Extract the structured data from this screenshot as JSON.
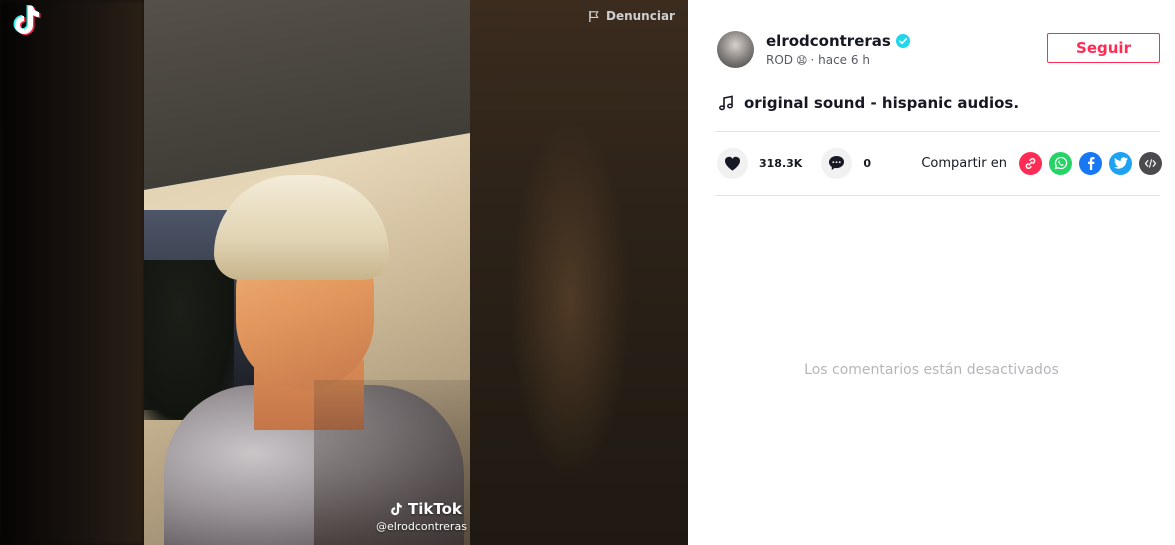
{
  "video": {
    "report_label": "Denunciar",
    "watermark_brand": "TikTok",
    "watermark_handle": "@elrodcontreras"
  },
  "author": {
    "username": "elrodcontreras",
    "display_name": "ROD",
    "display_name_emoji": "😧",
    "time_ago": "· hace 6 h"
  },
  "follow_label": "Seguir",
  "music": {
    "title": "original sound - hispanic audios."
  },
  "stats": {
    "likes": "318.3K",
    "comments": "0"
  },
  "share": {
    "label": "Compartir en",
    "targets": [
      "copy-link",
      "whatsapp",
      "facebook",
      "twitter",
      "embed"
    ]
  },
  "comments_disabled_text": "Los comentarios están desactivados",
  "colors": {
    "accent": "#fe2c55",
    "verified": "#20d5ec",
    "whatsapp": "#25d366",
    "facebook": "#1877f2",
    "twitter": "#1da1f2",
    "embed": "#4a4a4f"
  }
}
